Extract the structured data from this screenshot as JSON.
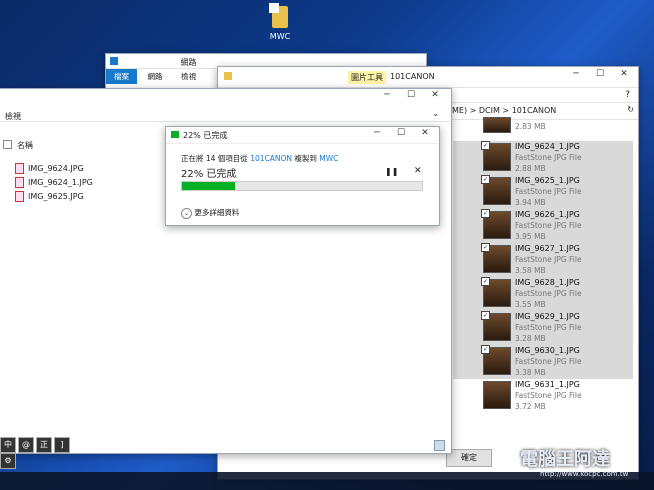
{
  "desktop": {
    "icon_label": "MWC"
  },
  "back_window": {
    "tabs": [
      "檔案",
      "網路",
      "檢視"
    ],
    "title": "網路"
  },
  "left_window": {
    "toolbar_label": "檢視",
    "column_header": "名稱",
    "files": [
      "IMG_9624.JPG",
      "IMG_9624_1.JPG",
      "IMG_9625.JPG"
    ]
  },
  "right_window": {
    "ribbon_highlight": "圖片工具",
    "title": "101CANON",
    "breadcrumb": [
      "ME)",
      "DCIM",
      "101CANON"
    ],
    "first_size": "2.83 MB",
    "files": [
      {
        "name": "IMG_9624_1.JPG",
        "type": "FastStone JPG File",
        "size": "2.88 MB",
        "selected": true
      },
      {
        "name": "IMG_9625_1.JPG",
        "type": "FastStone JPG File",
        "size": "3.94 MB",
        "selected": true
      },
      {
        "name": "IMG_9626_1.JPG",
        "type": "FastStone JPG File",
        "size": "3.95 MB",
        "selected": true
      },
      {
        "name": "IMG_9627_1.JPG",
        "type": "FastStone JPG File",
        "size": "3.58 MB",
        "selected": true
      },
      {
        "name": "IMG_9628_1.JPG",
        "type": "FastStone JPG File",
        "size": "3.55 MB",
        "selected": true
      },
      {
        "name": "IMG_9629_1.JPG",
        "type": "FastStone JPG File",
        "size": "3.28 MB",
        "selected": true
      },
      {
        "name": "IMG_9630_1.JPG",
        "type": "FastStone JPG File",
        "size": "3.38 MB",
        "selected": true
      },
      {
        "name": "IMG_9631_1.JPG",
        "type": "FastStone JPG File",
        "size": "3.72 MB",
        "selected": false
      }
    ],
    "ok_button": "確定"
  },
  "copy_dialog": {
    "title": "22% 已完成",
    "line_prefix": "正在將 14 個項目從",
    "source": "101CANON",
    "line_mid": "複製到",
    "dest": "MWC",
    "status": "22% 已完成",
    "progress": 0.22,
    "more_details": "更多詳細資料"
  },
  "watermark": {
    "text": "電腦王阿達",
    "url": "http://www.kocpc.com.tw"
  },
  "colors": {
    "accent": "#1979ca",
    "progress": "#06b025",
    "selected_row": "#d9d9d9"
  }
}
